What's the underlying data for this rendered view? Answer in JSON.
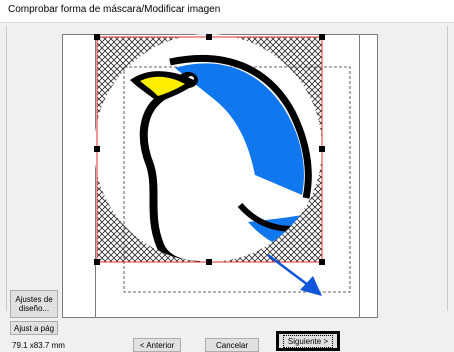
{
  "window": {
    "title": "Comprobar forma de máscara/Modificar imagen"
  },
  "sidebar": {
    "design_settings_label": "Ajustes de diseño...",
    "fit_page_label": "Ajust a pág",
    "size_readout": "79.1 x83.7 mm"
  },
  "footer": {
    "previous_label": "< Anterior",
    "cancel_label": "Cancelar",
    "next_label": "Siguiente >"
  },
  "colors": {
    "accent_blue": "#1177ee",
    "arrow_blue": "#1155dd",
    "beak_yellow": "#ffee00",
    "mask_border": "#e03030"
  }
}
